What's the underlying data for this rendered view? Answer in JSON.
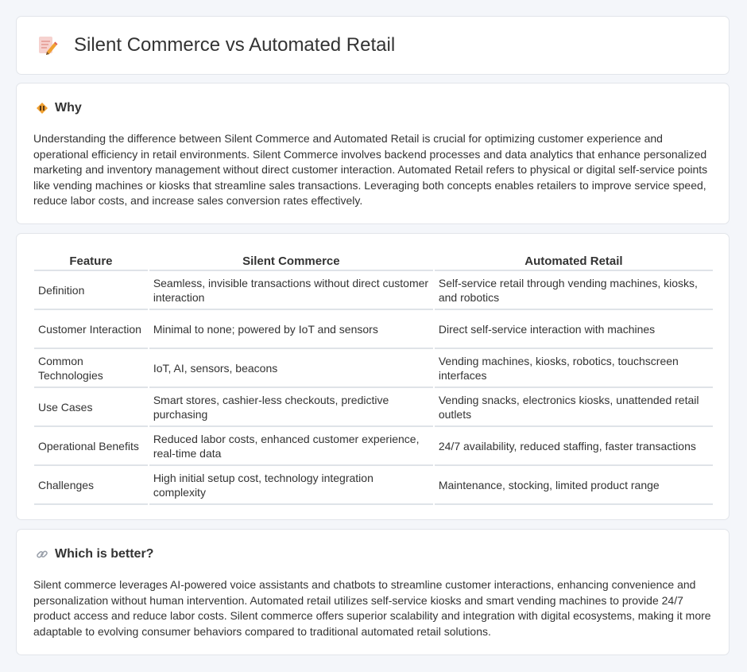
{
  "header": {
    "title": "Silent Commerce vs Automated Retail",
    "icon": "document-pencil-icon"
  },
  "why": {
    "title": "Why",
    "icon": "diamond-warning-icon",
    "body": "Understanding the difference between Silent Commerce and Automated Retail is crucial for optimizing customer experience and operational efficiency in retail environments. Silent Commerce involves backend processes and data analytics that enhance personalized marketing and inventory management without direct customer interaction. Automated Retail refers to physical or digital self-service points like vending machines or kiosks that streamline sales transactions. Leveraging both concepts enables retailers to improve service speed, reduce labor costs, and increase sales conversion rates effectively."
  },
  "table": {
    "headers": [
      "Feature",
      "Silent Commerce",
      "Automated Retail"
    ],
    "rows": [
      [
        "Definition",
        "Seamless, invisible transactions without direct customer interaction",
        "Self-service retail through vending machines, kiosks, and robotics"
      ],
      [
        "Customer Interaction",
        "Minimal to none; powered by IoT and sensors",
        "Direct self-service interaction with machines"
      ],
      [
        "Common Technologies",
        "IoT, AI, sensors, beacons",
        "Vending machines, kiosks, robotics, touchscreen interfaces"
      ],
      [
        "Use Cases",
        "Smart stores, cashier-less checkouts, predictive purchasing",
        "Vending snacks, electronics kiosks, unattended retail outlets"
      ],
      [
        "Operational Benefits",
        "Reduced labor costs, enhanced customer experience, real-time data",
        "24/7 availability, reduced staffing, faster transactions"
      ],
      [
        "Challenges",
        "High initial setup cost, technology integration complexity",
        "Maintenance, stocking, limited product range"
      ]
    ]
  },
  "better": {
    "title": "Which is better?",
    "icon": "link-icon",
    "body": "Silent commerce leverages AI-powered voice assistants and chatbots to streamline customer interactions, enhancing convenience and personalization without human intervention. Automated retail utilizes self-service kiosks and smart vending machines to provide 24/7 product access and reduce labor costs. Silent commerce offers superior scalability and integration with digital ecosystems, making it more adaptable to evolving consumer behaviors compared to traditional automated retail solutions."
  },
  "colors": {
    "background": "#f4f6fa",
    "card": "#ffffff",
    "border": "#e2e5ea",
    "text": "#333333",
    "icon_orange": "#f0a030"
  }
}
